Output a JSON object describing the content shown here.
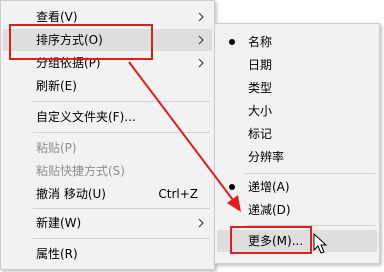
{
  "main_menu": {
    "items": [
      {
        "label": "查看(V)",
        "submenu": true
      },
      {
        "label": "排序方式(O)",
        "submenu": true
      },
      {
        "label": "分组依据(P)",
        "submenu": true
      },
      {
        "label": "刷新(E)"
      },
      {
        "label": "自定义文件夹(F)..."
      },
      {
        "label": "粘贴(P)"
      },
      {
        "label": "粘贴快捷方式(S)"
      },
      {
        "label": "撤消 移动(U)",
        "shortcut": "Ctrl+Z"
      },
      {
        "label": "新建(W)",
        "submenu": true
      },
      {
        "label": "属性(R)"
      }
    ]
  },
  "sort_submenu": {
    "items": [
      {
        "label": "名称"
      },
      {
        "label": "日期"
      },
      {
        "label": "类型"
      },
      {
        "label": "大小"
      },
      {
        "label": "标记"
      },
      {
        "label": "分辨率"
      },
      {
        "label": "递增(A)"
      },
      {
        "label": "递减(D)"
      },
      {
        "label": "更多(M)..."
      }
    ]
  },
  "colors": {
    "highlight_box": "#e01e1e",
    "menu_background": "#f2f2f2",
    "hover_background": "#dedede"
  }
}
